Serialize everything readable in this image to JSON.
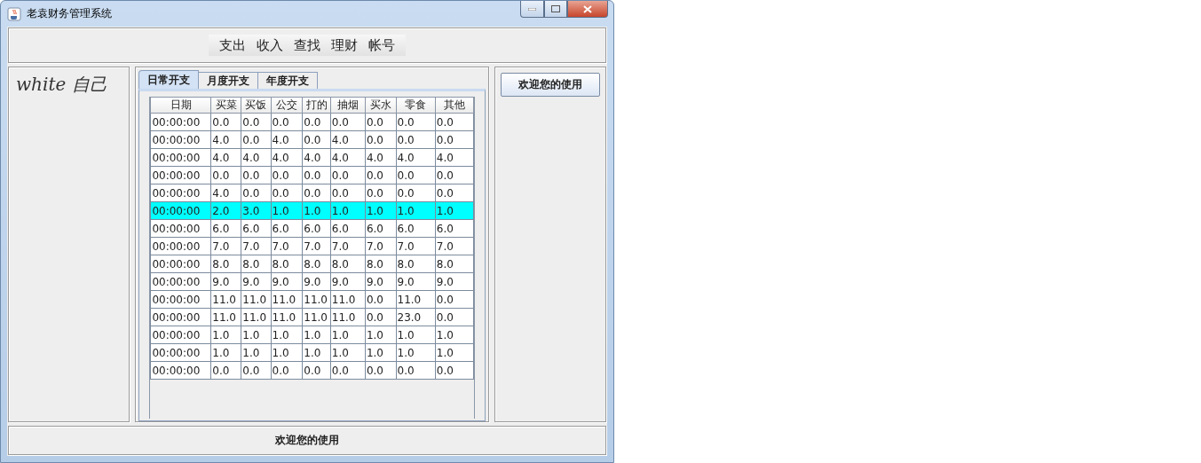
{
  "window": {
    "title": "老袁财务管理系统"
  },
  "menu": [
    "支出",
    "收入",
    "查找",
    "理财",
    "帐号"
  ],
  "user_label": "white 自己",
  "tabs": [
    {
      "label": "日常开支",
      "selected": true
    },
    {
      "label": "月度开支",
      "selected": false
    },
    {
      "label": "年度开支",
      "selected": false
    }
  ],
  "table": {
    "columns": [
      "日期",
      "买菜",
      "买饭",
      "公交",
      "打的",
      "抽烟",
      "买水",
      "零食",
      "其他"
    ],
    "rows": [
      {
        "cells": [
          "00:00:00",
          "0.0",
          "0.0",
          "0.0",
          "0.0",
          "0.0",
          "0.0",
          "0.0",
          "0.0"
        ],
        "selected": false
      },
      {
        "cells": [
          "00:00:00",
          "4.0",
          "0.0",
          "4.0",
          "0.0",
          "4.0",
          "0.0",
          "0.0",
          "0.0"
        ],
        "selected": false
      },
      {
        "cells": [
          "00:00:00",
          "4.0",
          "4.0",
          "4.0",
          "4.0",
          "4.0",
          "4.0",
          "4.0",
          "4.0"
        ],
        "selected": false
      },
      {
        "cells": [
          "00:00:00",
          "0.0",
          "0.0",
          "0.0",
          "0.0",
          "0.0",
          "0.0",
          "0.0",
          "0.0"
        ],
        "selected": false
      },
      {
        "cells": [
          "00:00:00",
          "4.0",
          "0.0",
          "0.0",
          "0.0",
          "0.0",
          "0.0",
          "0.0",
          "0.0"
        ],
        "selected": false
      },
      {
        "cells": [
          "00:00:00",
          "2.0",
          "3.0",
          "1.0",
          "1.0",
          "1.0",
          "1.0",
          "1.0",
          "1.0"
        ],
        "selected": true
      },
      {
        "cells": [
          "00:00:00",
          "6.0",
          "6.0",
          "6.0",
          "6.0",
          "6.0",
          "6.0",
          "6.0",
          "6.0"
        ],
        "selected": false
      },
      {
        "cells": [
          "00:00:00",
          "7.0",
          "7.0",
          "7.0",
          "7.0",
          "7.0",
          "7.0",
          "7.0",
          "7.0"
        ],
        "selected": false
      },
      {
        "cells": [
          "00:00:00",
          "8.0",
          "8.0",
          "8.0",
          "8.0",
          "8.0",
          "8.0",
          "8.0",
          "8.0"
        ],
        "selected": false
      },
      {
        "cells": [
          "00:00:00",
          "9.0",
          "9.0",
          "9.0",
          "9.0",
          "9.0",
          "9.0",
          "9.0",
          "9.0"
        ],
        "selected": false
      },
      {
        "cells": [
          "00:00:00",
          "11.0",
          "11.0",
          "11.0",
          "11.0",
          "11.0",
          "0.0",
          "11.0",
          "0.0"
        ],
        "selected": false
      },
      {
        "cells": [
          "00:00:00",
          "11.0",
          "11.0",
          "11.0",
          "11.0",
          "11.0",
          "0.0",
          "23.0",
          "0.0"
        ],
        "selected": false
      },
      {
        "cells": [
          "00:00:00",
          "1.0",
          "1.0",
          "1.0",
          "1.0",
          "1.0",
          "1.0",
          "1.0",
          "1.0"
        ],
        "selected": false
      },
      {
        "cells": [
          "00:00:00",
          "1.0",
          "1.0",
          "1.0",
          "1.0",
          "1.0",
          "1.0",
          "1.0",
          "1.0"
        ],
        "selected": false
      },
      {
        "cells": [
          "00:00:00",
          "0.0",
          "0.0",
          "0.0",
          "0.0",
          "0.0",
          "0.0",
          "0.0",
          "0.0"
        ],
        "selected": false
      }
    ]
  },
  "side_button": "欢迎您的使用",
  "status_bar": "欢迎您的使用"
}
